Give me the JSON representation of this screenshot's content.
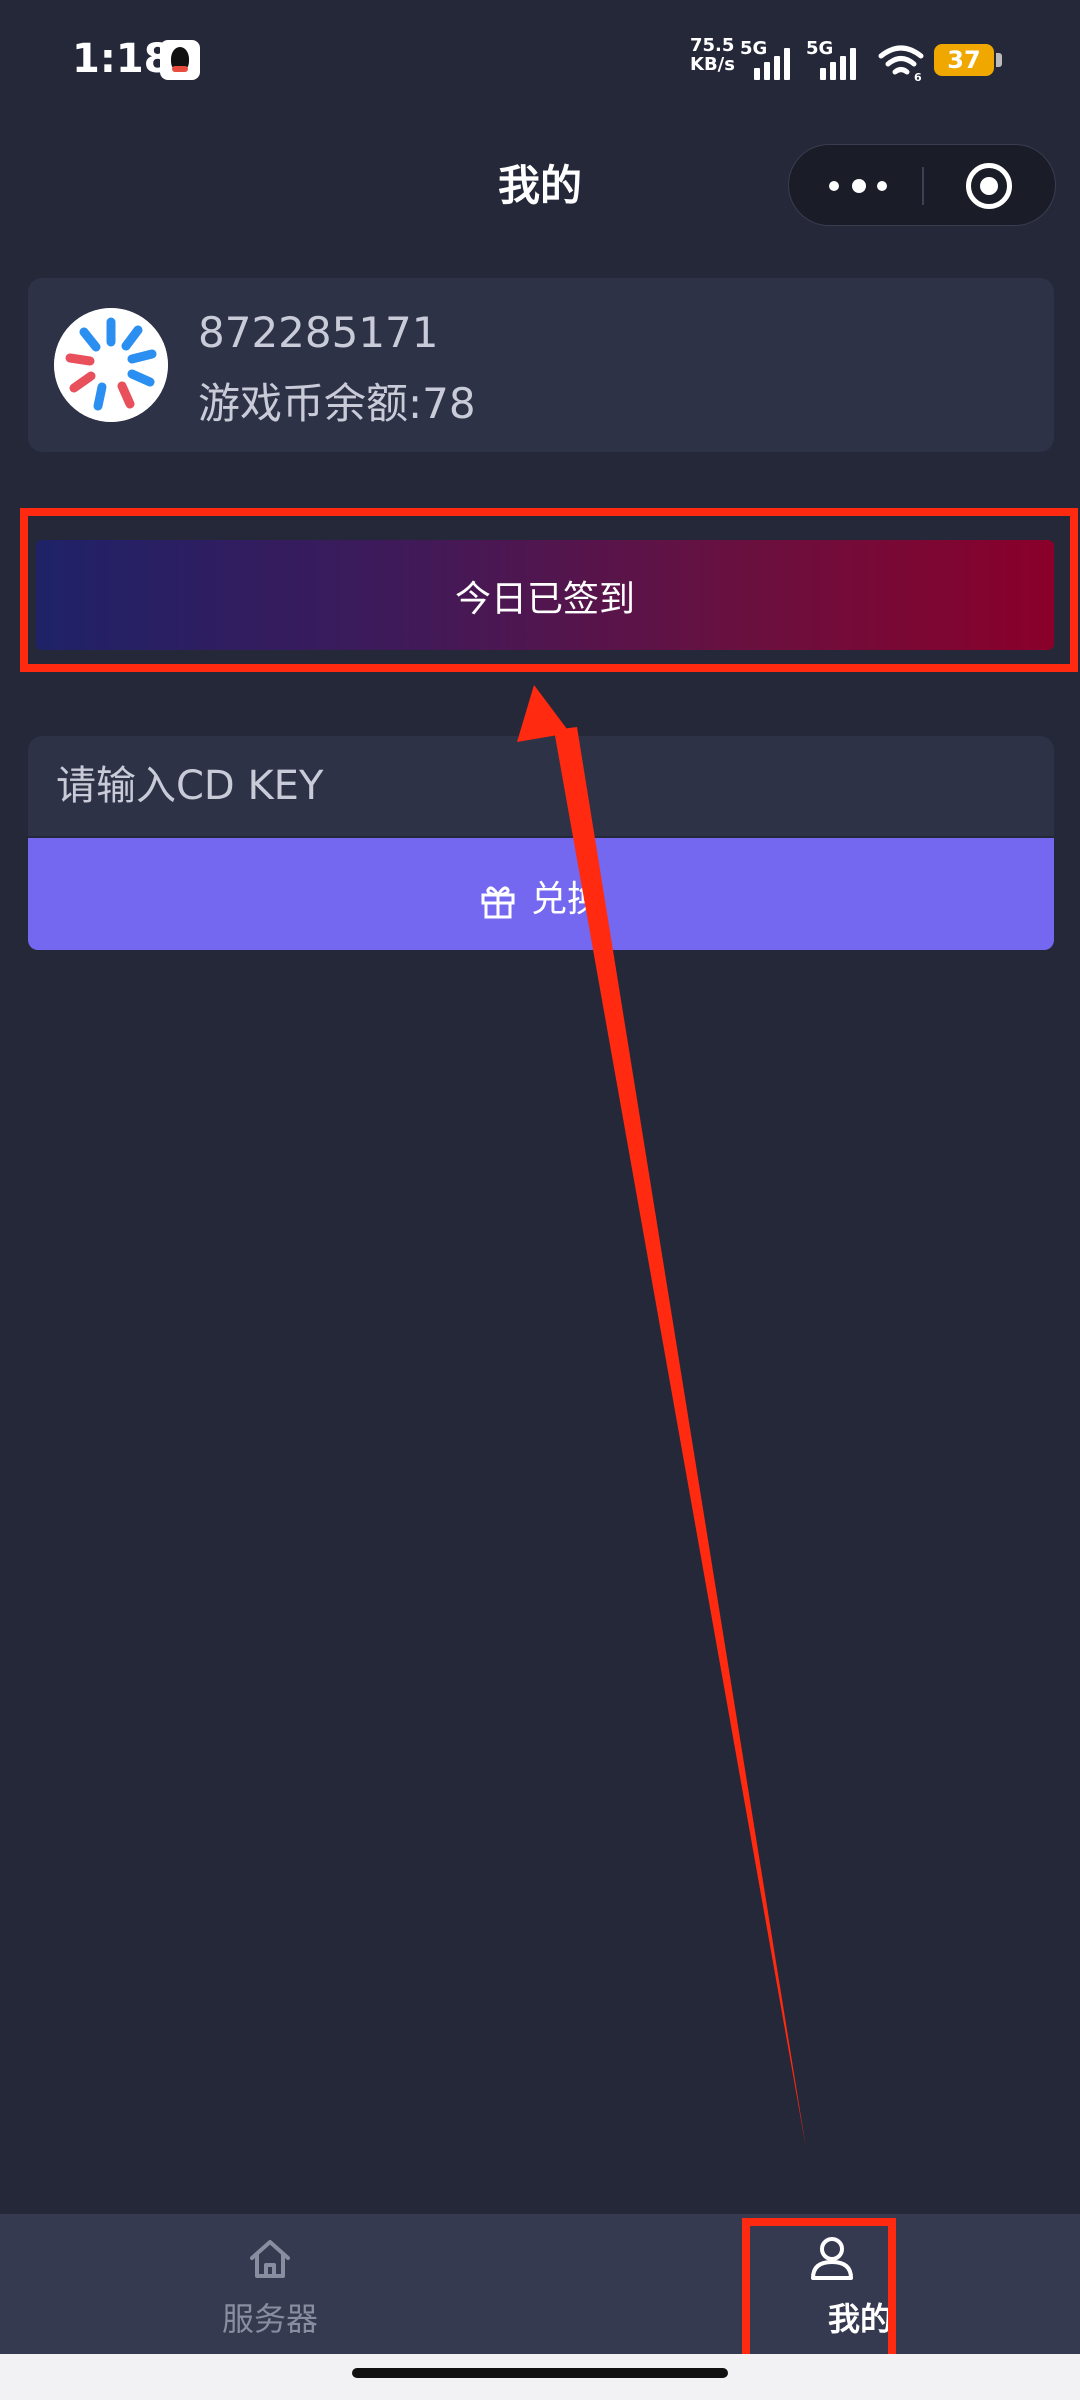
{
  "status_bar": {
    "time": "1:18",
    "net_speed_value": "75.5",
    "net_speed_unit": "KB/s",
    "signal1_label": "5G",
    "signal2_label": "5G",
    "wifi_badge": "6",
    "battery": "37",
    "icons": [
      "qq-icon",
      "signal-icon",
      "signal-icon",
      "wifi-icon",
      "battery-icon"
    ]
  },
  "header": {
    "title": "我的",
    "capsule_icons": [
      "more-icon",
      "target-icon"
    ]
  },
  "profile": {
    "user_id": "872285171",
    "balance": "游戏币余额:78"
  },
  "checkin": {
    "label": "今日已签到"
  },
  "cdkey": {
    "placeholder": "请输入CD KEY",
    "value": ""
  },
  "redeem": {
    "label": "兑换",
    "icon": "gift-icon"
  },
  "bottom_nav": {
    "items": [
      {
        "label": "服务器",
        "icon": "home-icon",
        "active": false
      },
      {
        "label": "我的",
        "icon": "user-icon",
        "active": true
      }
    ]
  },
  "colors": {
    "background": "#252839",
    "card": "#2e3247",
    "redeem_button": "#7568f0",
    "annotation": "#ff2a0f",
    "gradient_start": "#1f2268",
    "gradient_end": "#8a002a"
  }
}
